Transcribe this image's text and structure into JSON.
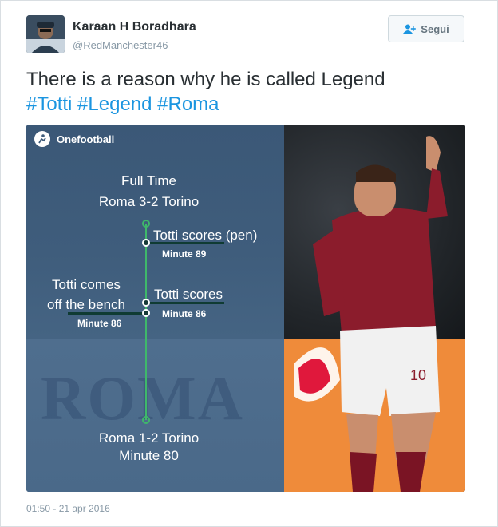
{
  "author": {
    "display_name": "Karaan H Boradhara",
    "username": "@RedManchester46"
  },
  "follow_button": {
    "label": "Segui"
  },
  "tweet": {
    "text": "There is a reason why he is called Legend",
    "hashtags": [
      "#Totti",
      "#Legend",
      "#Roma"
    ]
  },
  "media": {
    "brand": "Onefootball",
    "full_time_label": "Full Time",
    "final_score": "Roma 3-2 Torino",
    "event_pen": "Totti scores (pen)",
    "event_pen_minute": "Minute 89",
    "event_goal": "Totti scores",
    "event_goal_minute": "Minute 86",
    "sub_line1": "Totti comes",
    "sub_line2": "off the bench",
    "sub_minute": "Minute 86",
    "score_80": "Roma 1-2 Torino",
    "score_80_minute": "Minute 80",
    "watermark_text": "ROMA",
    "player_number": "10"
  },
  "timestamp": "01:50 - 21 apr 2016"
}
